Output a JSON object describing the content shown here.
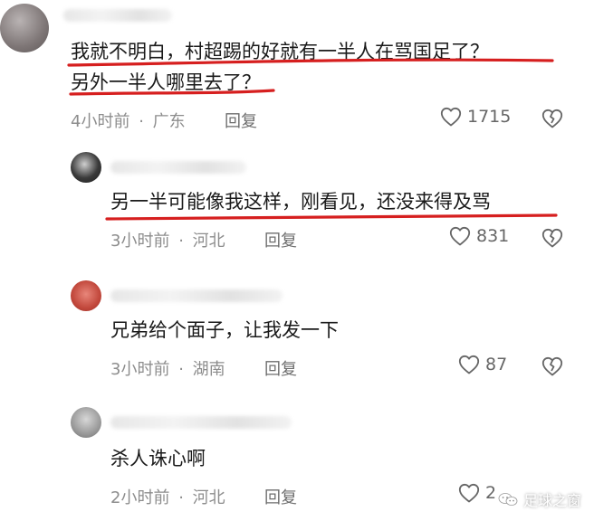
{
  "comments": [
    {
      "lines": [
        "我就不明白，村超踢的好就有一半人在骂国足了？",
        "另外一半人哪里去了？"
      ],
      "time": "4小时前",
      "location": "广东",
      "reply_label": "回复",
      "likes": "1715"
    },
    {
      "lines": [
        "另一半可能像我这样，刚看见，还没来得及骂"
      ],
      "time": "3小时前",
      "location": "河北",
      "reply_label": "回复",
      "likes": "831"
    },
    {
      "lines": [
        "兄弟给个面子，让我发一下"
      ],
      "time": "3小时前",
      "location": "湖南",
      "reply_label": "回复",
      "likes": "87"
    },
    {
      "lines": [
        "杀人诛心啊"
      ],
      "time": "2小时前",
      "location": "河北",
      "reply_label": "回复",
      "likes": "2"
    }
  ],
  "meta_separator": "·",
  "watermark": {
    "text": "足球之窗",
    "icon": "wechat-logo"
  },
  "colors": {
    "underline": "#d61f1f",
    "meta_text": "#8d8d8d",
    "body_text": "#1a1a1a"
  },
  "icons": {
    "like": "heart-outline-icon",
    "dislike": "broken-heart-icon"
  }
}
